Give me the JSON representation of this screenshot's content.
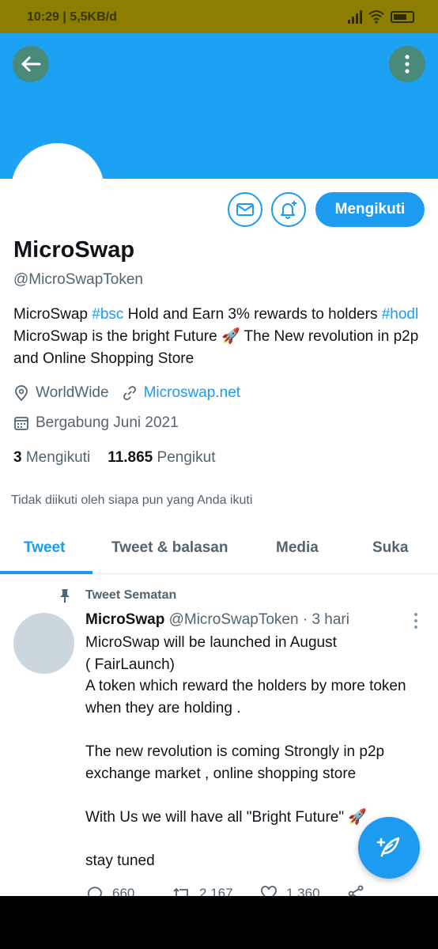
{
  "status_bar": {
    "time": "10:29 | 5,5KB/d"
  },
  "colors": {
    "accent": "#1d9bf0",
    "banner": "#1da1f2",
    "status_bar": "#8b7e00",
    "nav_bar": "#000000"
  },
  "profile": {
    "display_name": "MicroSwap",
    "handle": "@MicroSwapToken",
    "bio": {
      "t1": "MicroSwap ",
      "tag1": "#bsc",
      "t2": "  Hold and Earn  3% rewards to holders ",
      "tag2": "#hodl",
      "t3": "  MicroSwap is the bright Future 🚀  The New revolution in p2p and Online Shopping Store"
    },
    "location": "WorldWide",
    "website": "Microswap.net",
    "joined": "Bergabung Juni 2021",
    "following_count": "3",
    "following_label": "Mengikuti",
    "followers_count": "11.865",
    "followers_label": "Pengikut",
    "not_followed_note": "Tidak diikuti oleh siapa pun yang Anda ikuti",
    "follow_button": "Mengikuti",
    "icons": {
      "back": "arrow-left-icon",
      "more": "more-vertical-icon",
      "mail": "mail-icon",
      "bell": "bell-plus-icon"
    }
  },
  "tabs": [
    {
      "label": "Tweet",
      "active": true
    },
    {
      "label": "Tweet & balasan",
      "active": false
    },
    {
      "label": "Media",
      "active": false
    },
    {
      "label": "Suka",
      "active": false
    }
  ],
  "pinned_tweet": {
    "pinned_label": "Tweet Sematan",
    "author_name": "MicroSwap",
    "author_handle": "@MicroSwapToken",
    "time": "· 3 hari",
    "text": "MicroSwap will be launched in August\n( FairLaunch)\nA  token which reward the holders by more token when they are holding .\n\nThe new revolution is coming Strongly in p2p exchange market , online shopping store\n\nWith Us we will have all  \"Bright Future\" 🚀\n\nstay tuned",
    "replies": "660",
    "retweets": "2.167",
    "likes": "1.360"
  }
}
